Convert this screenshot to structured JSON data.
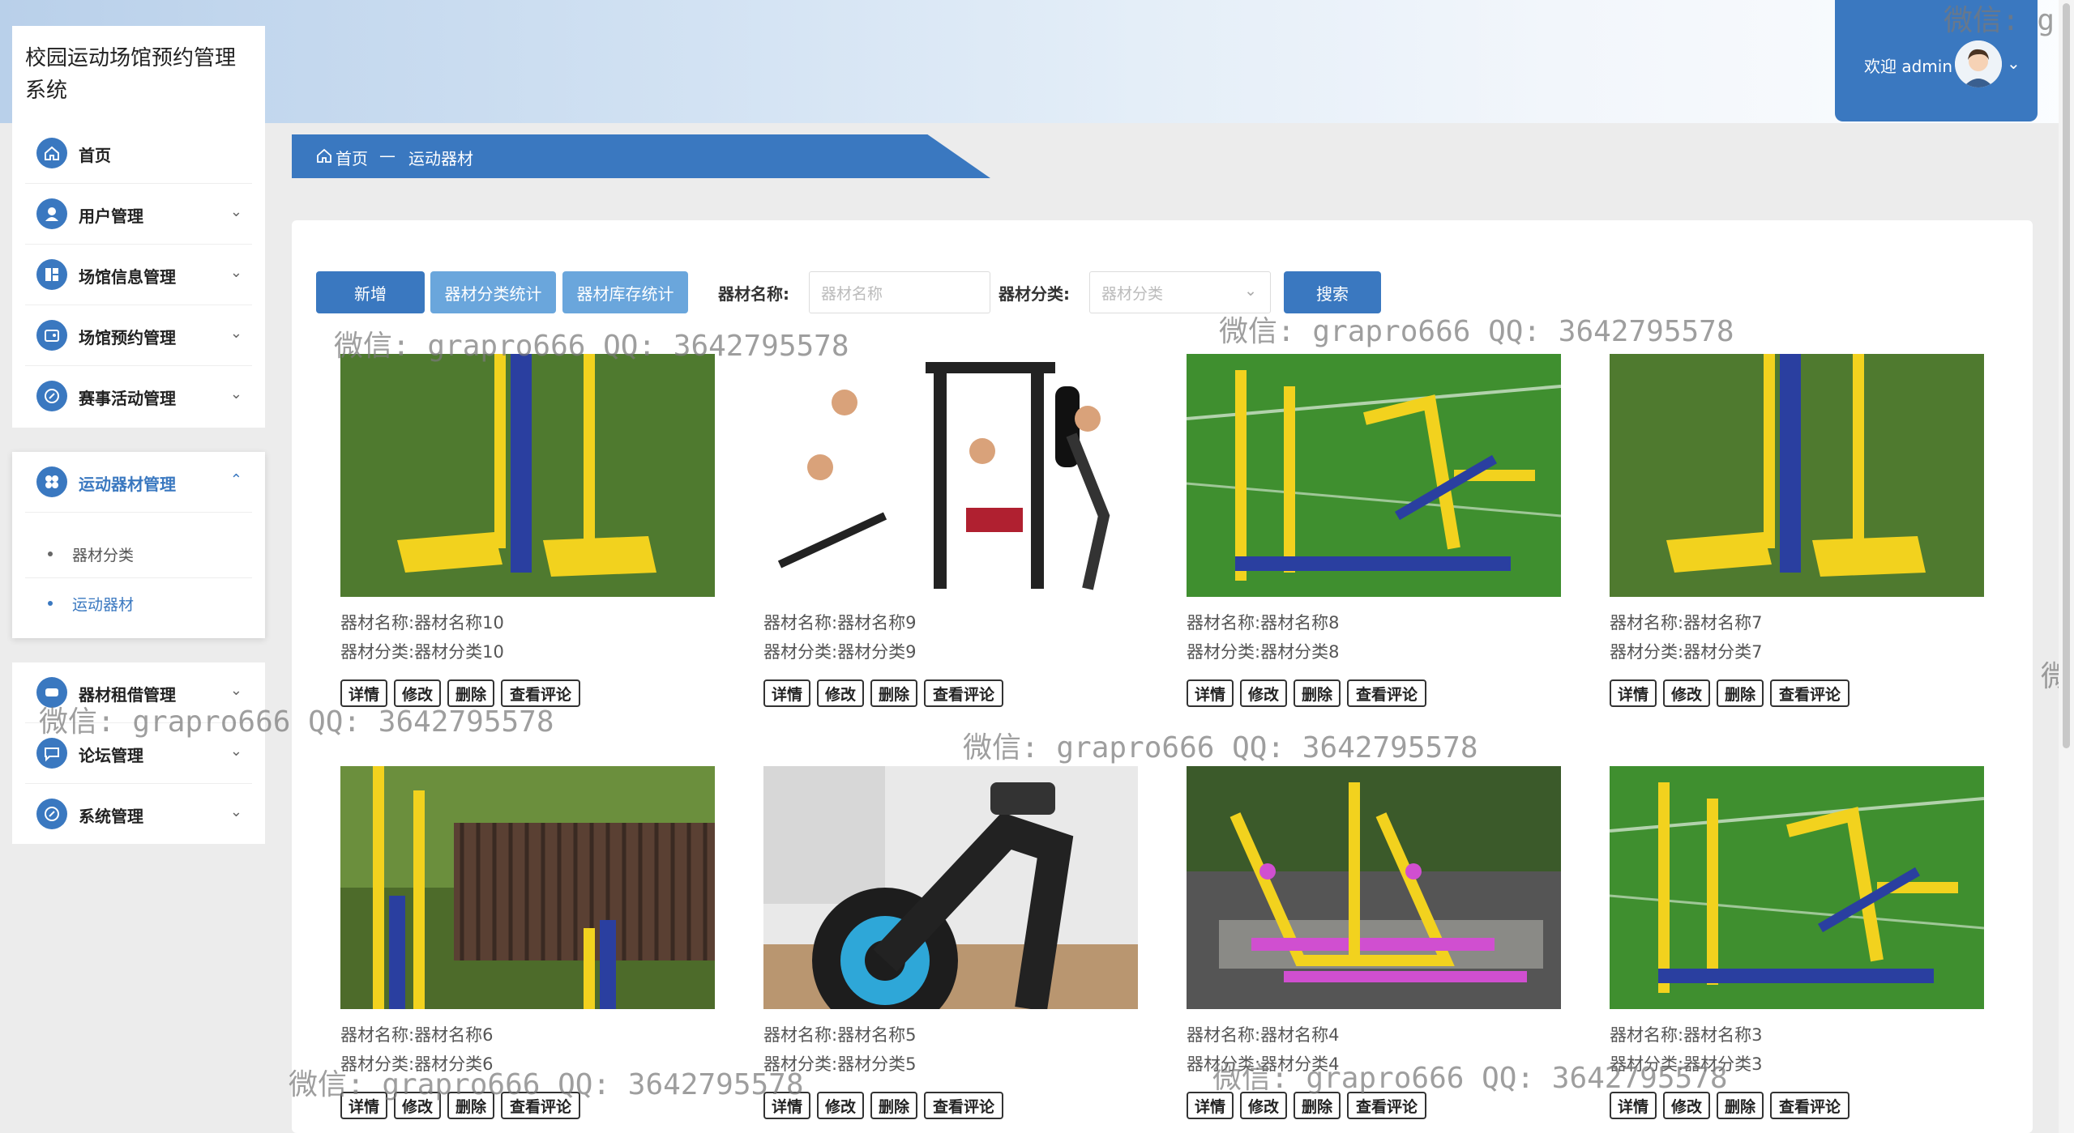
{
  "app": {
    "title": "校园运动场馆预约管理系统"
  },
  "user": {
    "welcome": "欢迎 admin"
  },
  "sidebar": {
    "items": [
      {
        "label": "首页",
        "icon": "home-icon"
      },
      {
        "label": "用户管理",
        "icon": "user-icon"
      },
      {
        "label": "场馆信息管理",
        "icon": "venue-icon"
      },
      {
        "label": "场馆预约管理",
        "icon": "booking-icon"
      },
      {
        "label": "赛事活动管理",
        "icon": "event-icon"
      },
      {
        "label": "运动器材管理",
        "icon": "equipment-icon",
        "children": [
          {
            "label": "器材分类"
          },
          {
            "label": "运动器材"
          }
        ]
      },
      {
        "label": "器材租借管理",
        "icon": "rental-icon"
      },
      {
        "label": "论坛管理",
        "icon": "forum-icon"
      },
      {
        "label": "系统管理",
        "icon": "system-icon"
      }
    ]
  },
  "breadcrumb": {
    "home": "首页",
    "separator": "—",
    "current": "运动器材"
  },
  "toolbar": {
    "add_label": "新增",
    "category_stats_label": "器材分类统计",
    "stock_stats_label": "器材库存统计",
    "name_label": "器材名称:",
    "name_placeholder": "器材名称",
    "category_label": "器材分类:",
    "category_placeholder": "器材分类",
    "search_label": "搜索"
  },
  "card_labels": {
    "name_prefix": "器材名称:",
    "category_prefix": "器材分类:",
    "detail": "详情",
    "edit": "修改",
    "delete": "删除",
    "comments": "查看评论"
  },
  "cards": [
    {
      "name": "器材名称10",
      "category": "器材分类10"
    },
    {
      "name": "器材名称9",
      "category": "器材分类9"
    },
    {
      "name": "器材名称8",
      "category": "器材分类8"
    },
    {
      "name": "器材名称7",
      "category": "器材分类7"
    },
    {
      "name": "器材名称6",
      "category": "器材分类6"
    },
    {
      "name": "器材名称5",
      "category": "器材分类5"
    },
    {
      "name": "器材名称4",
      "category": "器材分类4"
    },
    {
      "name": "器材名称3",
      "category": "器材分类3"
    }
  ],
  "watermark": "微信: grapro666 QQ: 3642795578",
  "watermark_partial_top": "微信: gr",
  "watermark_partial_right": "微",
  "colors": {
    "primary": "#3a78c0",
    "secondary_button": "#6aa6dc"
  }
}
